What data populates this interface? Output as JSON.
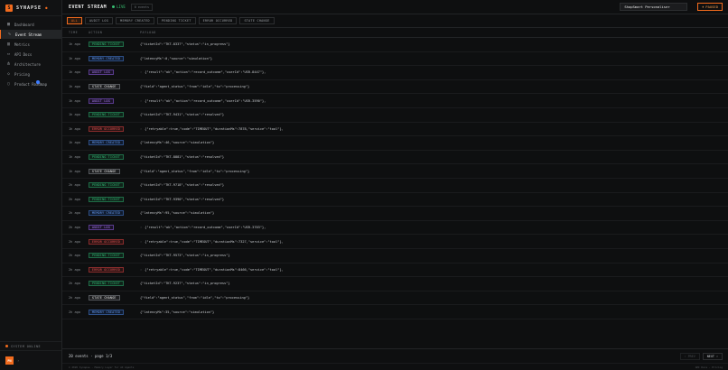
{
  "brand": {
    "name": "SYNAPSE",
    "logo_letter": "S"
  },
  "sidebar": {
    "items": [
      {
        "label": "Dashboard",
        "icon": "grid-icon",
        "glyph": "▦",
        "active": false
      },
      {
        "label": "Event Stream",
        "icon": "activity-icon",
        "glyph": "∿",
        "active": true
      },
      {
        "label": "Metrics",
        "icon": "bar-chart-icon",
        "glyph": "▥",
        "active": false
      },
      {
        "label": "API Docs",
        "icon": "book-icon",
        "glyph": "▭",
        "active": false
      },
      {
        "label": "Architecture",
        "icon": "network-icon",
        "glyph": "⋔",
        "active": false
      },
      {
        "label": "Pricing",
        "icon": "tag-icon",
        "glyph": "◇",
        "active": false
      },
      {
        "label": "Product Roadmap",
        "icon": "map-icon",
        "glyph": "▯",
        "active": false
      }
    ],
    "status": "SYSTEM ONLINE",
    "avatar": "PN"
  },
  "topbar": {
    "title": "EVENT STREAM",
    "live": "LIVE",
    "events_badge": "0 events",
    "agent": "ShopSmart Personaliser",
    "paused": "PAUSED"
  },
  "filters": [
    "ALL",
    "AUDIT LOG",
    "MEMORY CREATED",
    "PENDING TICKET",
    "ERROR OCCURRED",
    "STATE CHANGE"
  ],
  "table": {
    "headers": {
      "time": "TIME",
      "action": "ACTION",
      "payload": "PAYLOAD"
    },
    "rows": [
      {
        "time": "1h ago",
        "action": "PENDING TICKET",
        "kind": "pending",
        "chev": false,
        "payload": "{\"ticketId\":\"TKT-8337\",\"status\":\"in_progress\"}"
      },
      {
        "time": "1h ago",
        "action": "MEMORY CREATED",
        "kind": "memory",
        "chev": false,
        "payload": "{\"latencyMs\":0,\"source\":\"simulation\"}"
      },
      {
        "time": "1h ago",
        "action": "AUDIT LOG",
        "kind": "audit",
        "chev": true,
        "payload": "{\"result\":\"ok\",\"action\":\"record_outcome\",\"userId\":\"USR-8447\"},"
      },
      {
        "time": "1h ago",
        "action": "STATE CHANGE",
        "kind": "state",
        "chev": false,
        "payload": "{\"field\":\"agent_status\",\"from\":\"idle\",\"to\":\"processing\"}"
      },
      {
        "time": "1h ago",
        "action": "AUDIT LOG",
        "kind": "audit",
        "chev": true,
        "payload": "{\"result\":\"ok\",\"action\":\"record_outcome\",\"userId\":\"USR-3590\"},"
      },
      {
        "time": "1h ago",
        "action": "PENDING TICKET",
        "kind": "pending",
        "chev": false,
        "payload": "{\"ticketId\":\"TKT-9431\",\"status\":\"resolved\"}"
      },
      {
        "time": "1h ago",
        "action": "ERROR OCCURRED",
        "kind": "error",
        "chev": true,
        "payload": "{\"retryable\":true,\"code\":\"TIMEOUT\",\"durationMs\":7878,\"service\":\"tool\"},"
      },
      {
        "time": "1h ago",
        "action": "MEMORY CREATED",
        "kind": "memory",
        "chev": false,
        "payload": "{\"latencyMs\":46,\"source\":\"simulation\"}"
      },
      {
        "time": "1h ago",
        "action": "PENDING TICKET",
        "kind": "pending",
        "chev": false,
        "payload": "{\"ticketId\":\"TKT-8881\",\"status\":\"resolved\"}"
      },
      {
        "time": "1h ago",
        "action": "STATE CHANGE",
        "kind": "state",
        "chev": false,
        "payload": "{\"field\":\"agent_status\",\"from\":\"idle\",\"to\":\"processing\"}"
      },
      {
        "time": "2h ago",
        "action": "PENDING TICKET",
        "kind": "pending",
        "chev": false,
        "payload": "{\"ticketId\":\"TKT-9718\",\"status\":\"resolved\"}"
      },
      {
        "time": "2h ago",
        "action": "PENDING TICKET",
        "kind": "pending",
        "chev": false,
        "payload": "{\"ticketId\":\"TKT-9390\",\"status\":\"resolved\"}"
      },
      {
        "time": "2h ago",
        "action": "MEMORY CREATED",
        "kind": "memory",
        "chev": false,
        "payload": "{\"latencyMs\":95,\"source\":\"simulation\"}"
      },
      {
        "time": "2h ago",
        "action": "AUDIT LOG",
        "kind": "audit",
        "chev": true,
        "payload": "{\"result\":\"ok\",\"action\":\"record_outcome\",\"userId\":\"USR-3703\"},"
      },
      {
        "time": "2h ago",
        "action": "ERROR OCCURRED",
        "kind": "error",
        "chev": true,
        "payload": "{\"retryable\":true,\"code\":\"TIMEOUT\",\"durationMs\":7327,\"service\":\"tool\"},"
      },
      {
        "time": "2h ago",
        "action": "PENDING TICKET",
        "kind": "pending",
        "chev": false,
        "payload": "{\"ticketId\":\"TKT-9573\",\"status\":\"in_progress\"}"
      },
      {
        "time": "2h ago",
        "action": "ERROR OCCURRED",
        "kind": "error",
        "chev": true,
        "payload": "{\"retryable\":true,\"code\":\"TIMEOUT\",\"durationMs\":8466,\"service\":\"tool\"},"
      },
      {
        "time": "2h ago",
        "action": "PENDING TICKET",
        "kind": "pending",
        "chev": false,
        "payload": "{\"ticketId\":\"TKT-9237\",\"status\":\"in_progress\"}"
      },
      {
        "time": "2h ago",
        "action": "STATE CHANGE",
        "kind": "state",
        "chev": false,
        "payload": "{\"field\":\"agent_status\",\"from\":\"idle\",\"to\":\"processing\"}"
      },
      {
        "time": "2h ago",
        "action": "MEMORY CREATED",
        "kind": "memory",
        "chev": false,
        "payload": "{\"latencyMs\":35,\"source\":\"simulation\"}"
      }
    ]
  },
  "footer": {
    "count": "20 events · page 1/3",
    "prev": "‹ PREV",
    "next": "NEXT ›"
  },
  "copyright": {
    "left": "© 2026 Synapse · Memory Layer for AI Agents",
    "right": "API Docs · Pricing"
  },
  "colors": {
    "accent": "#f26b1d",
    "live": "#38c172",
    "cursor": "#3d7cff"
  }
}
